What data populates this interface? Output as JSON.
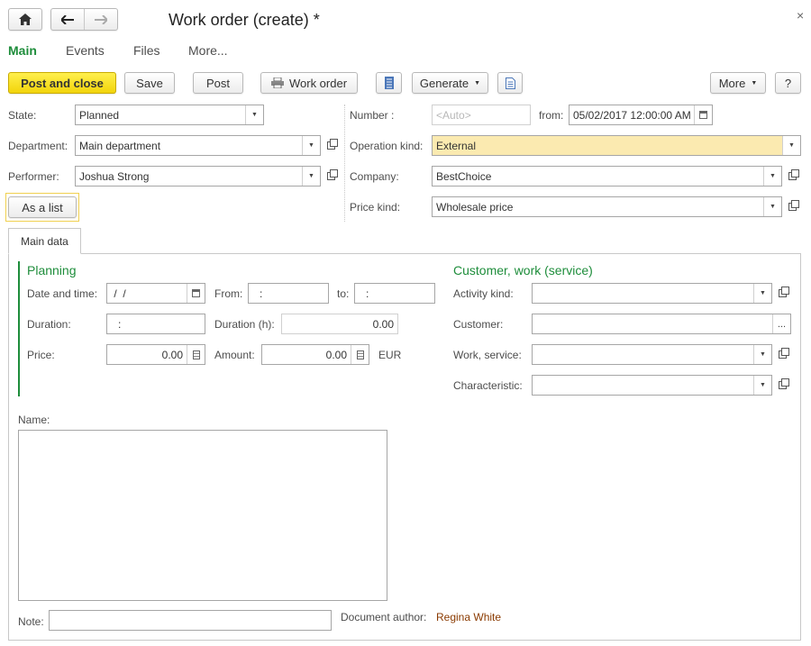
{
  "window": {
    "title": "Work order (create) *",
    "close_glyph": "×"
  },
  "tabs": [
    {
      "label": "Main",
      "active": true
    },
    {
      "label": "Events"
    },
    {
      "label": "Files"
    },
    {
      "label": "More..."
    }
  ],
  "toolbar": {
    "post_and_close": "Post and close",
    "save": "Save",
    "post": "Post",
    "work_order": "Work order",
    "generate": "Generate",
    "more": "More",
    "help": "?"
  },
  "header": {
    "state_label": "State:",
    "state_value": "Planned",
    "department_label": "Department:",
    "department_value": "Main department",
    "performer_label": "Performer:",
    "performer_value": "Joshua Strong",
    "as_list": "As a list",
    "number_label": "Number :",
    "number_placeholder": "<Auto>",
    "from_label": "from:",
    "date_value": "05/02/2017 12:00:00 AM",
    "operation_kind_label": "Operation kind:",
    "operation_kind_value": "External",
    "company_label": "Company:",
    "company_value": "BestChoice",
    "price_kind_label": "Price kind:",
    "price_kind_value": "Wholesale price"
  },
  "main_tab": {
    "label": "Main data"
  },
  "planning": {
    "title": "Planning",
    "date_time_label": "Date and time:",
    "date_time_value": " /  /",
    "from_label": "From:",
    "from_value": ":",
    "to_label": "to:",
    "to_value": ":",
    "duration_label": "Duration:",
    "duration_value": ":",
    "duration_h_label": "Duration (h):",
    "duration_h_value": "0.00",
    "price_label": "Price:",
    "price_value": "0.00",
    "amount_label": "Amount:",
    "amount_value": "0.00",
    "currency": "EUR"
  },
  "customer": {
    "title": "Customer, work (service)",
    "activity_kind_label": "Activity kind:",
    "customer_label": "Customer:",
    "customer_btn": "...",
    "work_service_label": "Work, service:",
    "characteristic_label": "Characteristic:"
  },
  "footer": {
    "name_label": "Name:",
    "note_label": "Note:",
    "author_label": "Document author:",
    "author_value": "Regina White"
  },
  "colors": {
    "accent_green": "#1e8d3b",
    "primary_yellow": "#f7e020",
    "highlight_field": "#fbeab0",
    "author_link": "#8a3a00"
  }
}
